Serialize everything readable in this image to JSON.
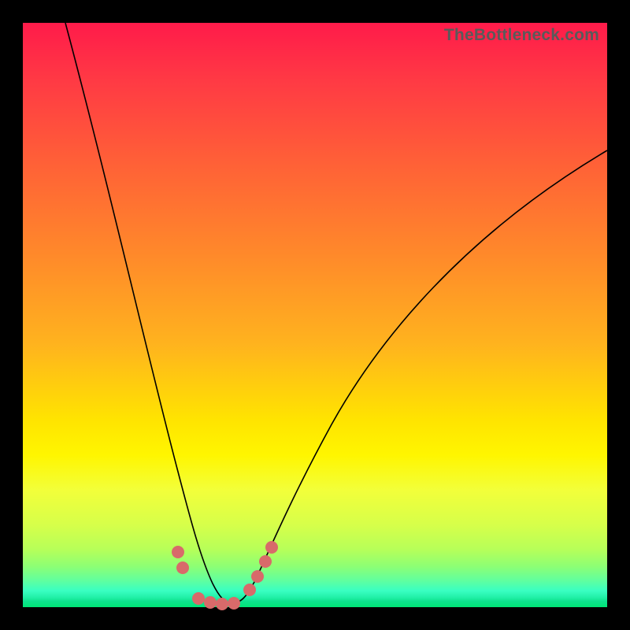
{
  "watermark": "TheBottleneck.com",
  "colors": {
    "frame": "#000000",
    "gradient_top": "#ff1b4a",
    "gradient_mid": "#ffe400",
    "gradient_bottom": "#00e676",
    "curve": "#000000",
    "markers": "#d86a6a"
  },
  "chart_data": {
    "type": "line",
    "title": "",
    "xlabel": "",
    "ylabel": "",
    "xlim": [
      0,
      100
    ],
    "ylim": [
      0,
      100
    ],
    "note": "No axes, ticks, or numeric labels are visible in the image. Values below are pixel-proportional estimates on a 0–100 scale.",
    "series": [
      {
        "name": "curve",
        "type": "line",
        "x": [
          7,
          10,
          13,
          16,
          19,
          22,
          24,
          26,
          28,
          30,
          31,
          32,
          33,
          34,
          35,
          37,
          39,
          41,
          44,
          48,
          54,
          62,
          72,
          84,
          100
        ],
        "y": [
          100,
          85,
          72,
          60,
          49,
          38,
          30,
          23,
          16,
          10,
          6,
          3,
          1,
          0.4,
          0.6,
          1.5,
          4,
          8,
          14,
          22,
          32,
          44,
          56,
          67,
          78
        ]
      }
    ],
    "markers": [
      {
        "x": 26.5,
        "y": 9
      },
      {
        "x": 27.3,
        "y": 6.5
      },
      {
        "x": 30.0,
        "y": 1.2
      },
      {
        "x": 32.0,
        "y": 0.6
      },
      {
        "x": 34.0,
        "y": 0.5
      },
      {
        "x": 36.0,
        "y": 0.6
      },
      {
        "x": 38.8,
        "y": 2.8
      },
      {
        "x": 40.2,
        "y": 5.0
      },
      {
        "x": 41.5,
        "y": 7.5
      },
      {
        "x": 42.5,
        "y": 10.0
      }
    ]
  }
}
